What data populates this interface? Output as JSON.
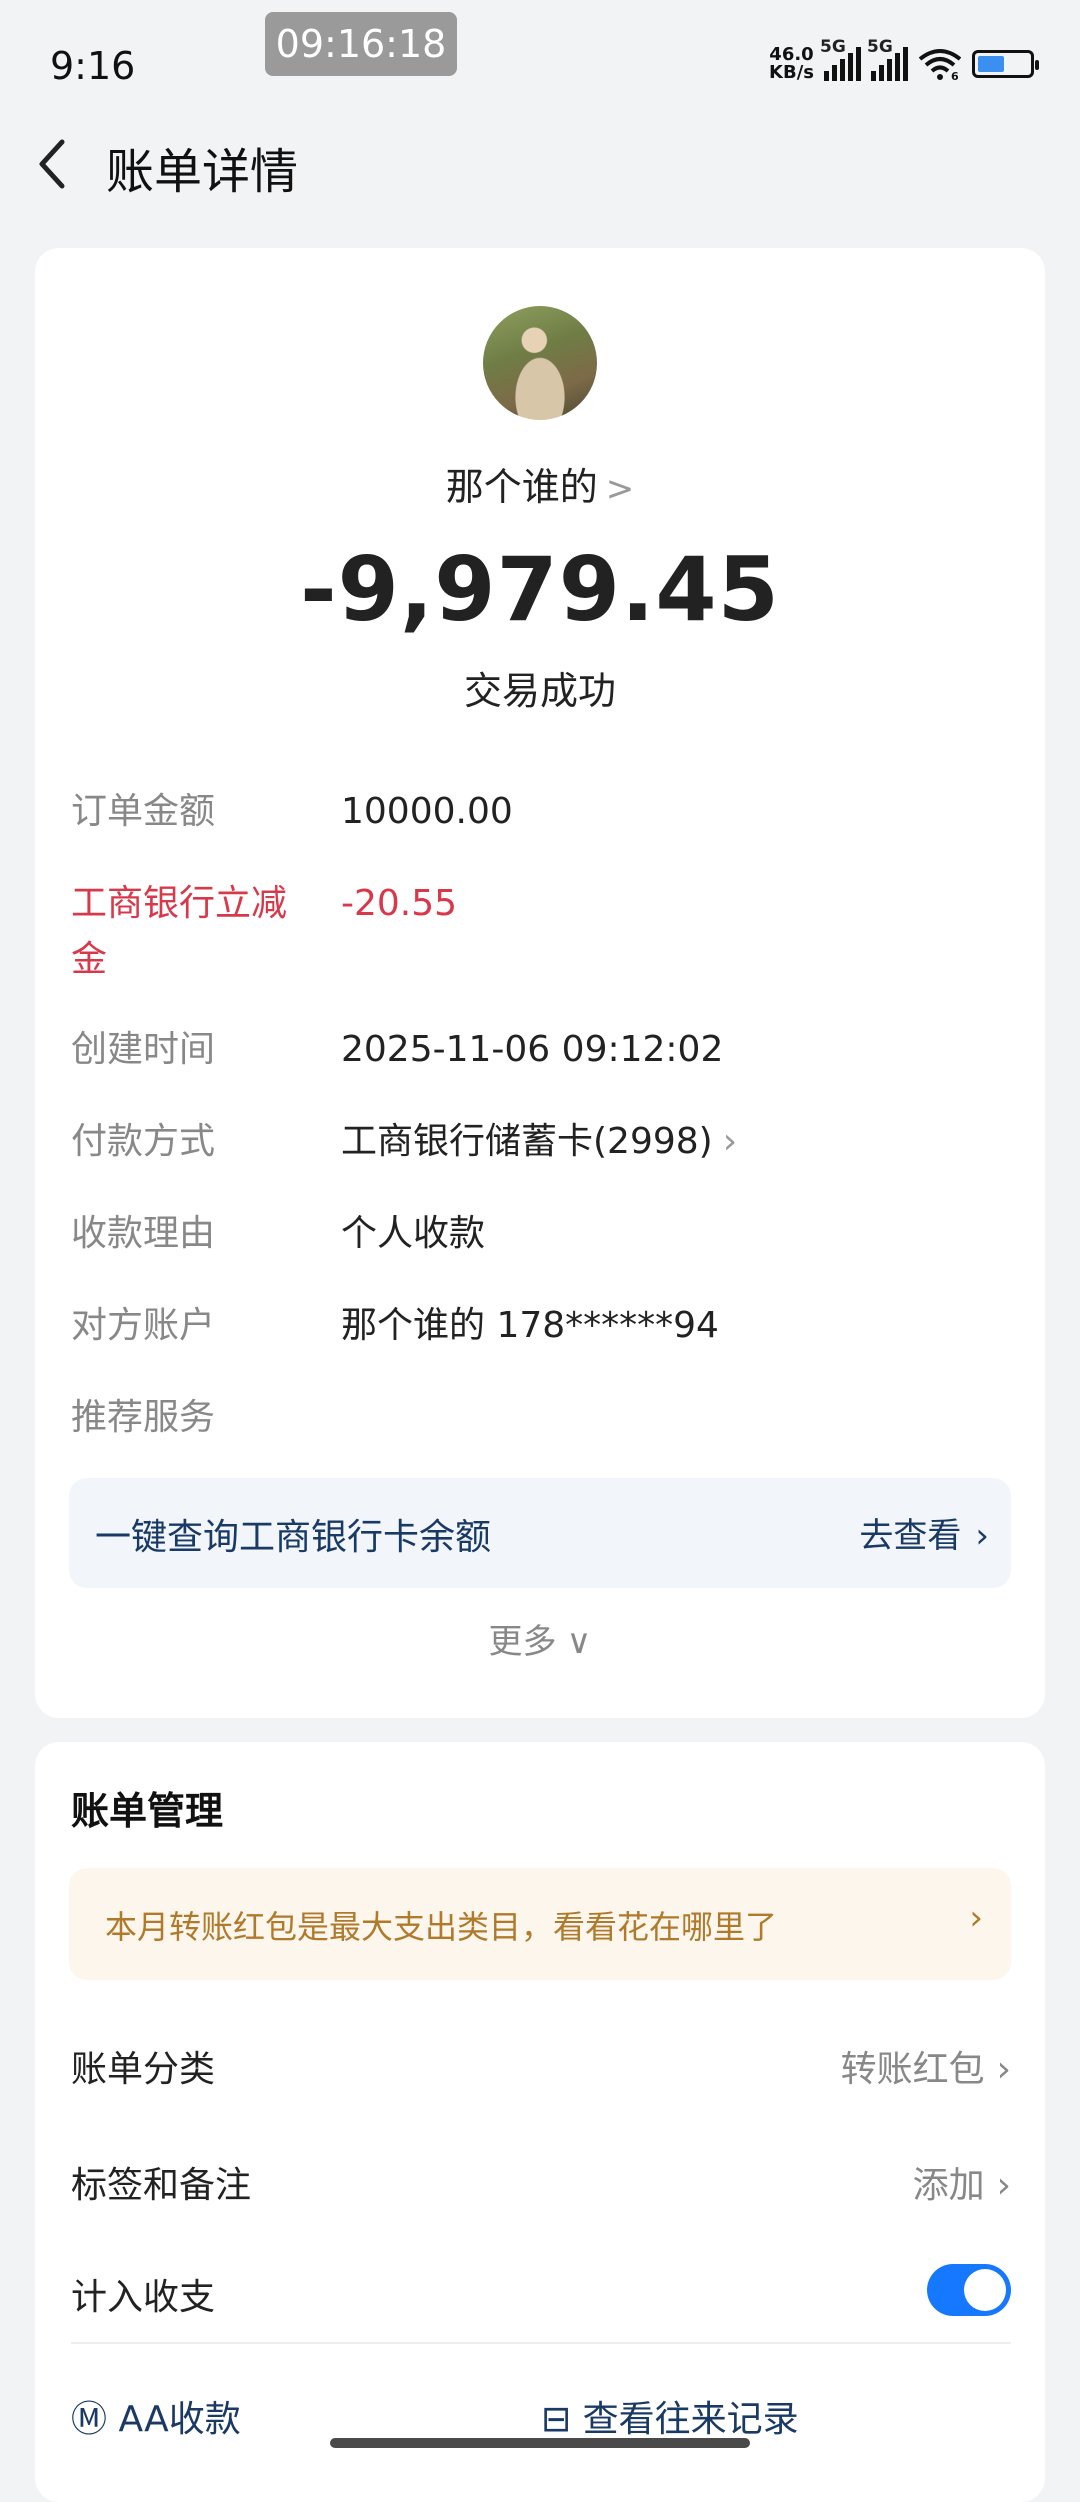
{
  "status_bar": {
    "time": "9:16",
    "overlay_time": "09:16:18",
    "net_speed_value": "46.0",
    "net_speed_unit": "KB/s",
    "signal1_label": "5G",
    "signal2_label": "5G",
    "wifi_badge": "6",
    "battery_level": 0.5
  },
  "header": {
    "title": "账单详情"
  },
  "payment": {
    "payee_name": "那个谁的",
    "payee_chevron": ">",
    "amount": "-9,979.45",
    "status": "交易成功"
  },
  "details": [
    {
      "key": "订单金额",
      "value": "10000.00"
    },
    {
      "key": "工商银行立减金",
      "value": "-20.55"
    },
    {
      "key": "创建时间",
      "value": "2025-11-06 09:12:02"
    },
    {
      "key": "付款方式",
      "value": "工商银行储蓄卡(2998)"
    },
    {
      "key": "收款理由",
      "value": "个人收款"
    },
    {
      "key": "对方账户",
      "value": "那个谁的 178******94"
    },
    {
      "key": "推荐服务",
      "value": ""
    }
  ],
  "service": {
    "text": "一键查询工商银行卡余额",
    "action": "去查看"
  },
  "more_label": "更多",
  "management": {
    "title": "账单管理",
    "banner": "本月转账红包是最大支出类目，看看花在哪里了",
    "category_label": "账单分类",
    "category_value": "转账红包",
    "tags_label": "标签和备注",
    "tags_value": "添加",
    "count_label": "计入收支",
    "count_enabled": true,
    "aa_label": "AA收款",
    "records_label": "查看往来记录"
  },
  "icons": {
    "back": "back-arrow-icon",
    "chevron": "chevron-right-icon",
    "more": "chevron-down-icon",
    "wifi": "wifi-icon",
    "battery": "battery-icon"
  },
  "colors": {
    "accent_blue": "#1677ff",
    "discount_red": "#d8394a",
    "banner_text": "#b07a2c",
    "banner_bg": "#fdf6ec"
  }
}
